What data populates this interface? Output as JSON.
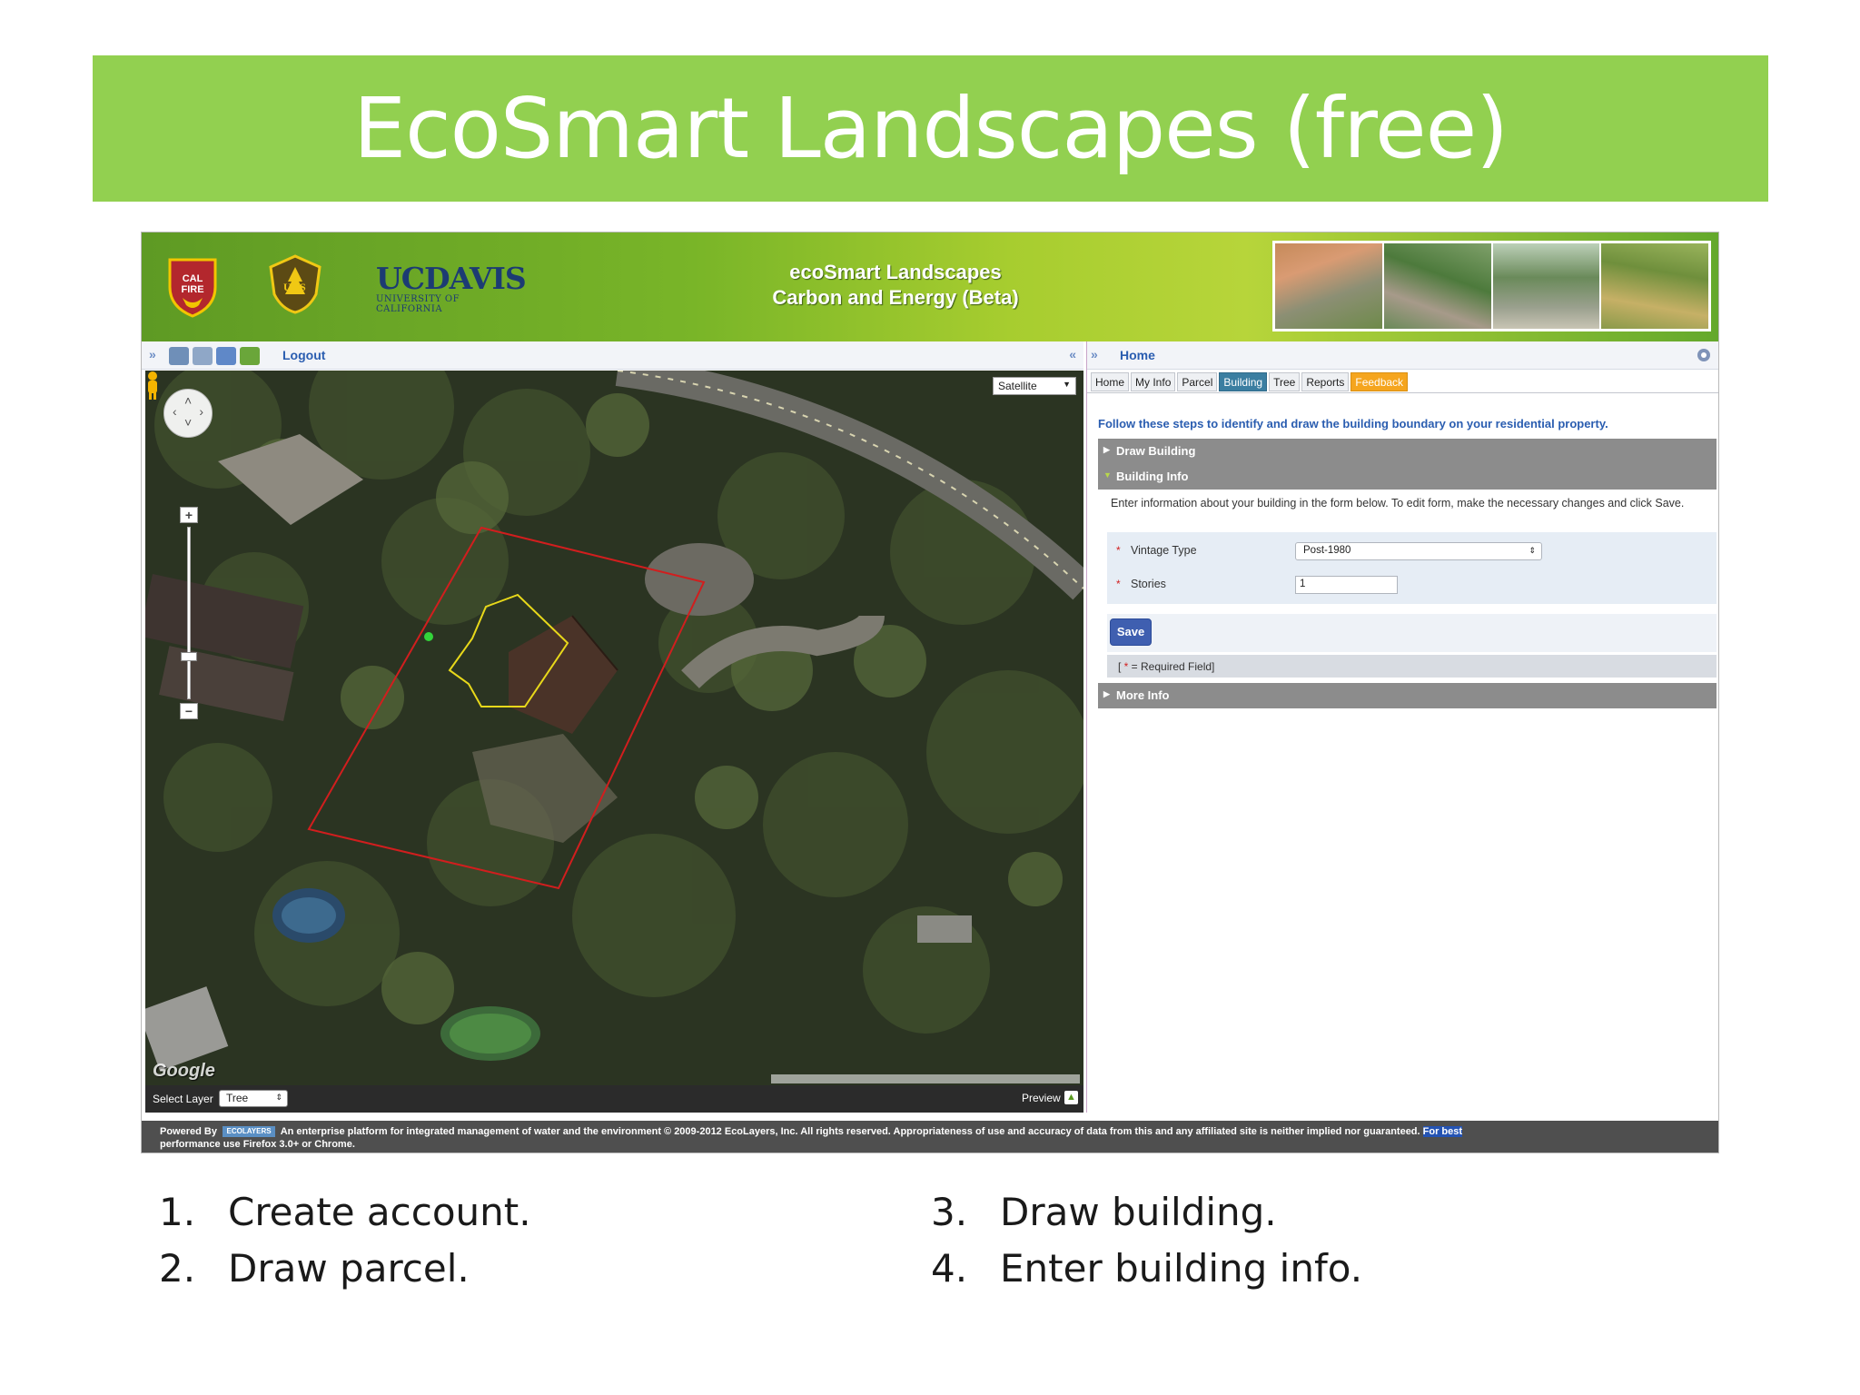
{
  "slide": {
    "title": "EcoSmart Landscapes (free)",
    "title_bar_color": "#92d050"
  },
  "app": {
    "header": {
      "title_line1": "ecoSmart Landscapes",
      "title_line2": "Carbon and Energy (Beta)",
      "logos": [
        "cal-fire-logo",
        "us-forest-service-logo",
        "uc-davis-logo"
      ],
      "ucdavis_name": "UCDAVIS",
      "ucdavis_sub": "UNIVERSITY OF CALIFORNIA"
    },
    "left_toolbar": {
      "expand": "»",
      "collapse": "«",
      "logout_label": "Logout",
      "icons": [
        "print-icon",
        "clipboard-icon",
        "home-icon",
        "tree-icon"
      ]
    },
    "map": {
      "map_type": "Satellite",
      "google_mark": "Google",
      "pan_arrows": [
        "‹",
        "›",
        "˄",
        "˅"
      ]
    },
    "layer_bar": {
      "label": "Select Layer",
      "value": "Tree",
      "preview_label": "Preview"
    },
    "right_panel": {
      "expand": "»",
      "home_label": "Home",
      "tabs": [
        "Home",
        "My Info",
        "Parcel",
        "Building",
        "Tree",
        "Reports",
        "Feedback"
      ],
      "active_tab": "Building",
      "steps_text": "Follow these steps to identify and draw the building boundary on your residential property.",
      "draw_building_label": "Draw Building",
      "building_info_label": "Building Info",
      "info_text": "Enter information about your building in the form below. To edit form, make the necessary changes and click Save.",
      "vintage_label": "Vintage Type",
      "vintage_value": "Post-1980",
      "stories_label": "Stories",
      "stories_value": "1",
      "save_label": "Save",
      "required_note_prefix": "[ ",
      "required_note_star": "*",
      "required_note_suffix": " = Required Field]",
      "more_info_label": "More Info"
    },
    "footer": {
      "powered_by": "Powered By",
      "ecolayers": "ECOLAYERS",
      "text": "An enterprise platform for integrated management of water and the environment  © 2009-2012 EcoLayers, Inc. All rights reserved. Appropriateness of use and accuracy of data from this and any affiliated site is neither implied nor guaranteed.",
      "best_text_1": "For best",
      "best_text_2": "performance use Firefox 3.0+ or Chrome."
    }
  },
  "steps": [
    {
      "num": "1.",
      "text": "Create account."
    },
    {
      "num": "2.",
      "text": "Draw parcel."
    },
    {
      "num": "3.",
      "text": "Draw building."
    },
    {
      "num": "4.",
      "text": "Enter building info."
    }
  ]
}
